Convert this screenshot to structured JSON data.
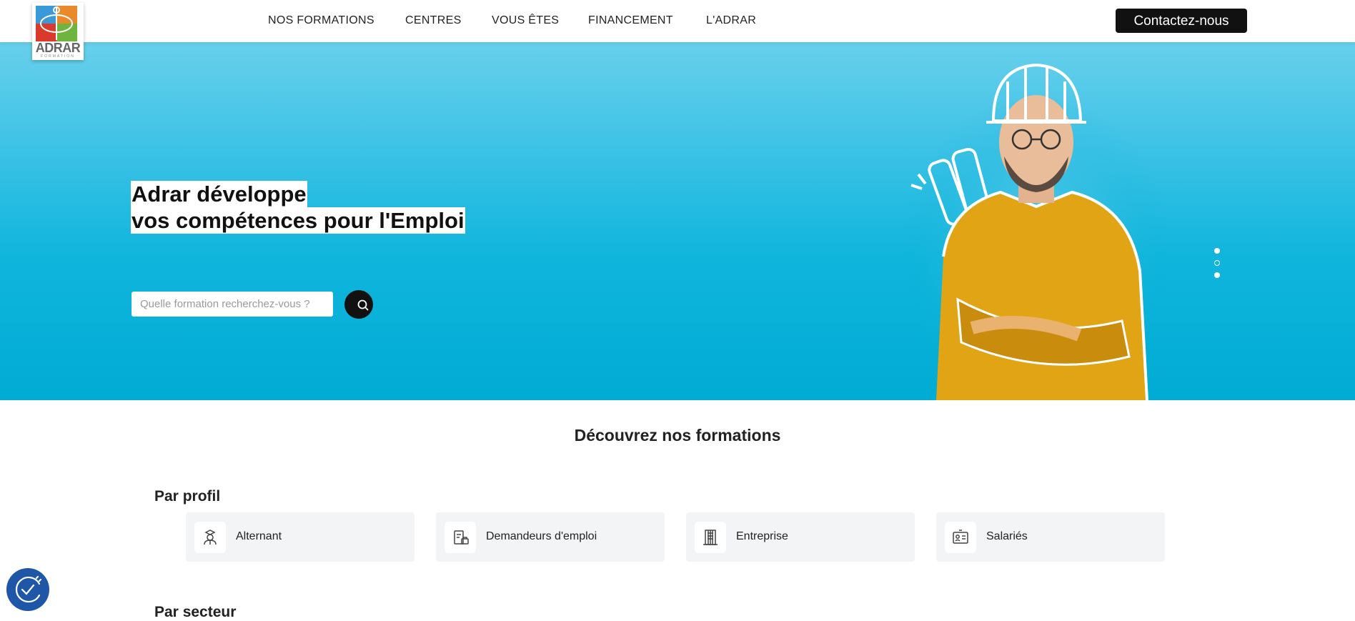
{
  "logo": {
    "name": "ADRAR",
    "tagline": "FORMATION"
  },
  "nav": {
    "items": [
      "NOS FORMATIONS",
      "CENTRES",
      "VOUS ÊTES",
      "FINANCEMENT",
      "L'ADRAR"
    ],
    "contact_label": "Contactez-nous"
  },
  "hero": {
    "headline_line1": "Adrar développe",
    "headline_line2": "vos compétences pour l'Emploi",
    "search_placeholder": "Quelle formation recherchez-vous ?",
    "slides_total": 3,
    "active_slide": 1
  },
  "main": {
    "title": "Découvrez nos formations",
    "profile_heading": "Par profil",
    "profiles": [
      {
        "label": "Alternant",
        "icon": "apprentice-icon"
      },
      {
        "label": "Demandeurs d'emploi",
        "icon": "job-seeker-icon"
      },
      {
        "label": "Entreprise",
        "icon": "building-icon"
      },
      {
        "label": "Salariés",
        "icon": "id-card-icon"
      }
    ],
    "sector_heading": "Par secteur"
  },
  "colors": {
    "hero_top": "#68d0ec",
    "hero_bottom": "#00abd4",
    "button_dark": "#111111",
    "accessibility": "#1e56a8"
  }
}
